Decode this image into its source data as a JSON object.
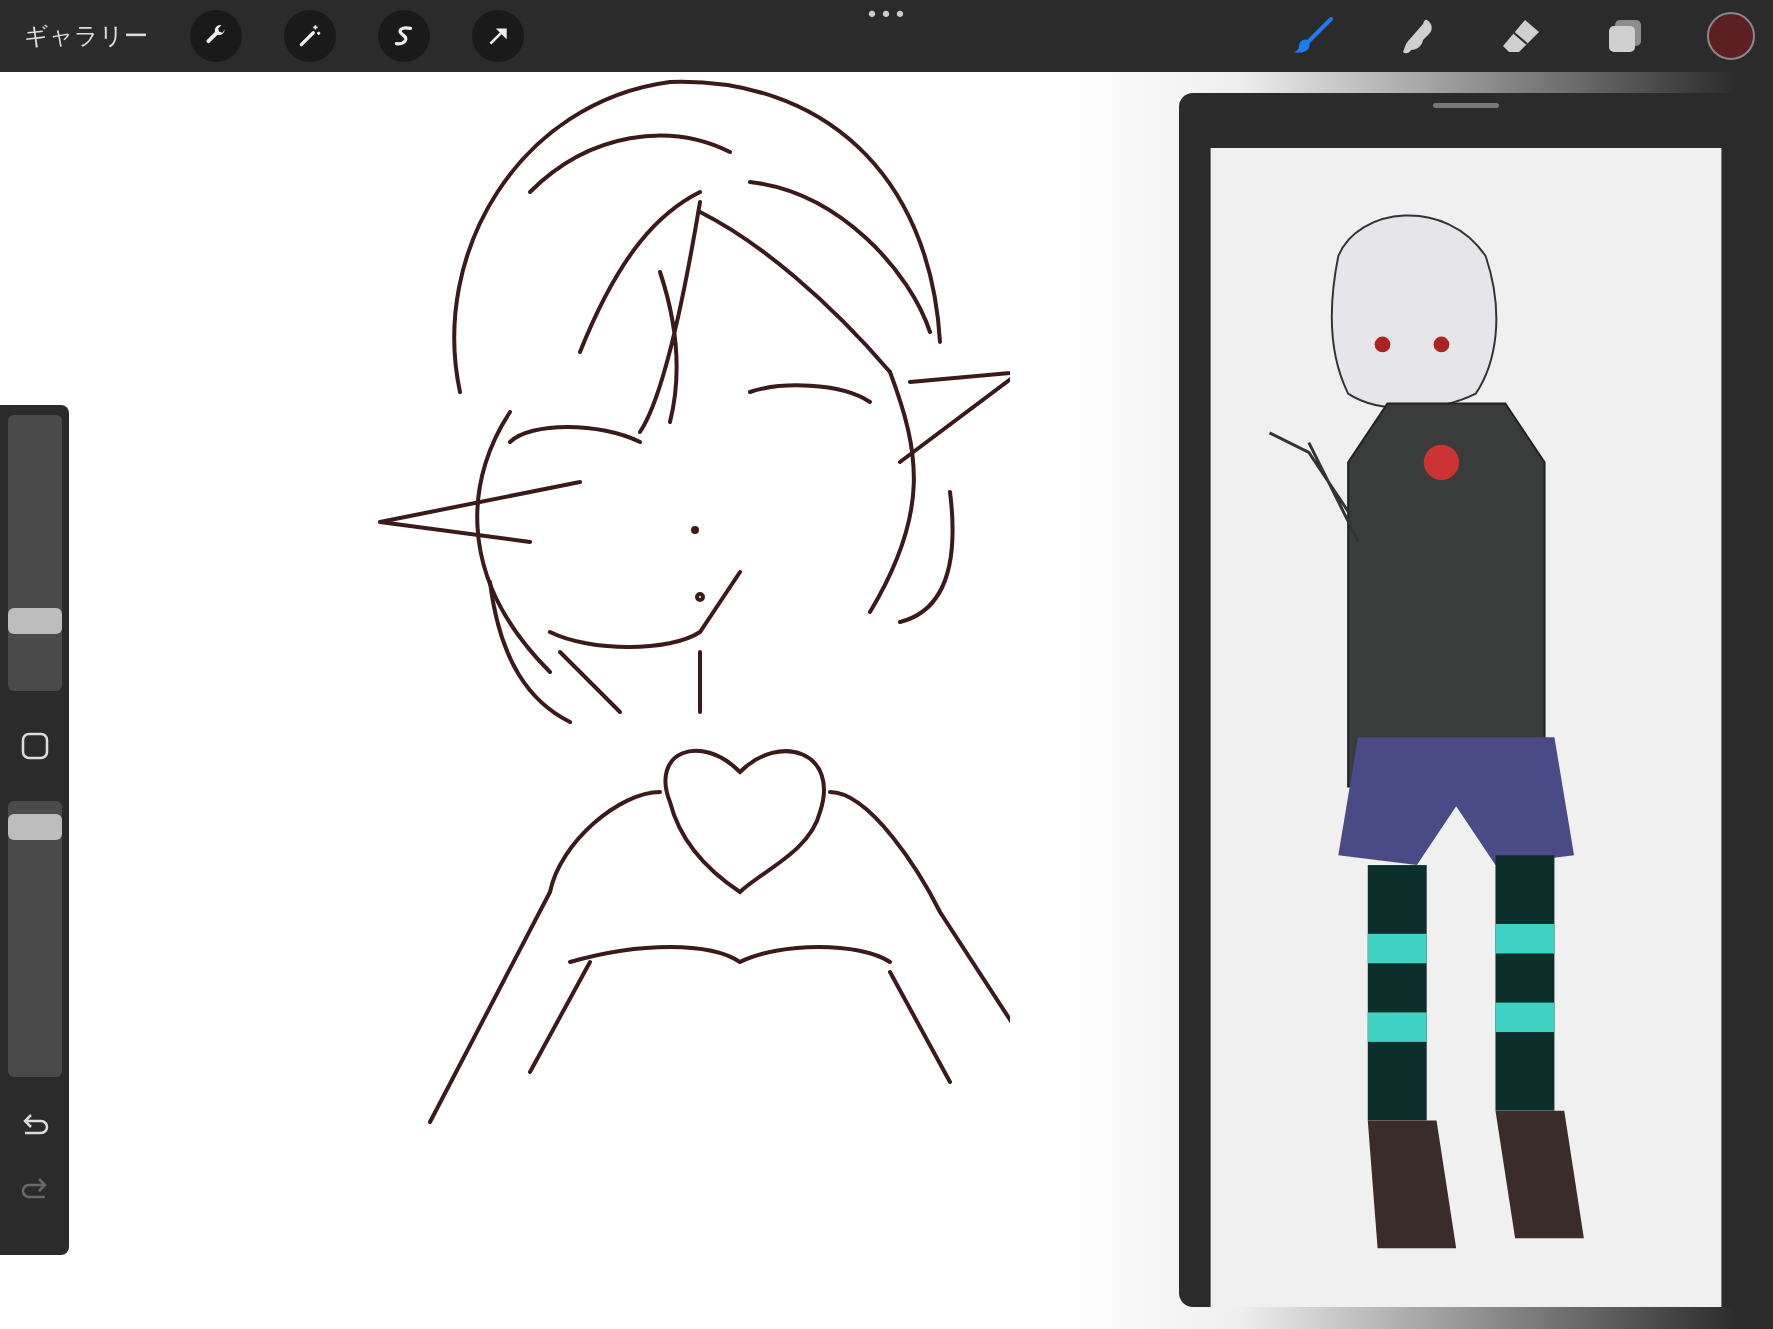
{
  "top_bar": {
    "gallery_label": "ギャラリー",
    "more_icon": "•••",
    "tools": [
      {
        "kind": "brush",
        "selected": true
      },
      {
        "kind": "smudge",
        "selected": false
      },
      {
        "kind": "eraser",
        "selected": false
      },
      {
        "kind": "layers",
        "selected": false
      }
    ],
    "current_color": {
      "color": "#5c1f23"
    }
  },
  "sidebar": {
    "size_slider": {
      "level": 0.23
    },
    "opacity_slider": {
      "level": 0.95
    },
    "undo": {
      "disabled": false
    },
    "redo": {
      "disabled": true
    }
  },
  "reference_window": {
    "open": true
  }
}
